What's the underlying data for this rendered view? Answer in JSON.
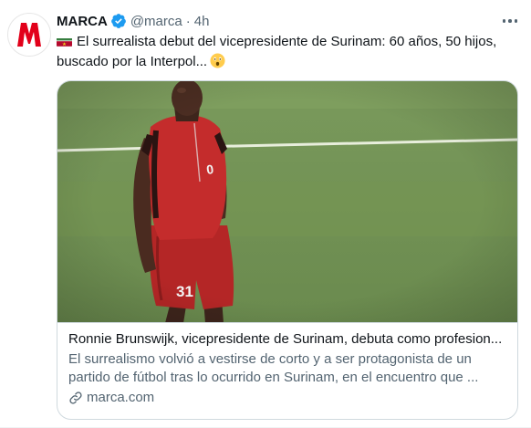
{
  "tweet": {
    "author_name": "MARCA",
    "author_handle": "@marca",
    "separator": "·",
    "time": "4h",
    "text": "El surrealista debut del vicepresidente de Surinam: 60 años, 50 hijos, buscado por la Interpol...",
    "flag_icon": "suriname-flag-icon",
    "emoji_icon": "astonished-face-icon"
  },
  "card": {
    "title": "Ronnie Brunswijk, vicepresidente de Surinam, debuta como profesion...",
    "description": "El surrealismo volvió a vestirse de corto y a ser protagonista de un partido de fútbol tras lo ocurrido en Surinam, en el encuentro que ...",
    "domain": "marca.com",
    "image": {
      "jersey_number": "31",
      "colors": {
        "pitch": "#6f8f54",
        "jersey": "#c42c2c",
        "skin": "#4b2d22"
      }
    }
  },
  "colors": {
    "accent": "#1d9bf0",
    "text": "#0f1419",
    "secondary": "#536471",
    "border": "#cfd9de",
    "brand": "#e2001a"
  }
}
